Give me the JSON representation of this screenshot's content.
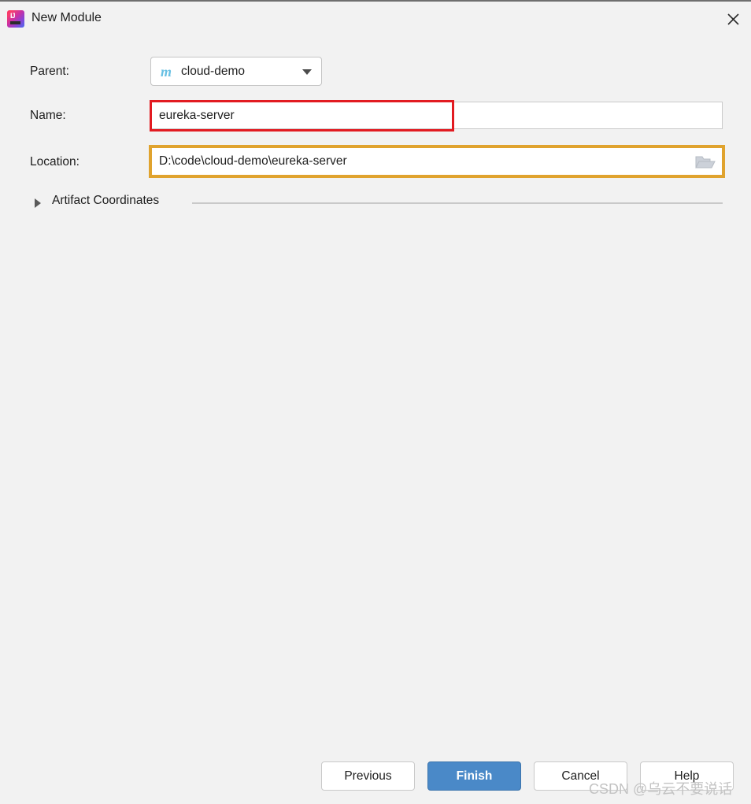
{
  "window": {
    "title": "New Module",
    "app_icon": "intellij-idea-icon",
    "close_icon": "close-icon"
  },
  "form": {
    "parent": {
      "label": "Parent:",
      "icon": "maven-module-icon",
      "icon_glyph": "m",
      "value": "cloud-demo",
      "arrow_icon": "chevron-down-icon"
    },
    "name": {
      "label": "Name:",
      "value": "eureka-server",
      "placeholder": ""
    },
    "location": {
      "label": "Location:",
      "value": "D:\\code\\cloud-demo\\eureka-server",
      "placeholder": "",
      "browse_icon": "folder-open-icon"
    }
  },
  "artifact_section": {
    "label": "Artifact Coordinates",
    "expanded": false,
    "toggle_icon": "chevron-right-icon"
  },
  "buttons": {
    "previous": "Previous",
    "finish": "Finish",
    "cancel": "Cancel",
    "help": "Help"
  },
  "watermark": {
    "text": "CSDN @乌云不要说话"
  },
  "colors": {
    "dialog_background": "#f2f2f2",
    "finish_button": "#4a89c8",
    "name_highlight": "#e21b21",
    "location_highlight": "#e0a32e",
    "maven_icon": "#68c0e3",
    "field_border": "#c9c9c9"
  }
}
